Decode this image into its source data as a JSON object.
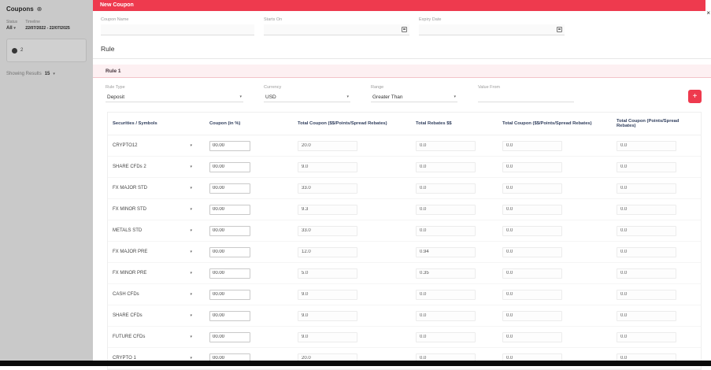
{
  "colors": {
    "accent": "#ee3a4e",
    "rule_header_bg": "#fdf0f2",
    "table_header_text": "#32405f"
  },
  "sidebar": {
    "title": "Coupons",
    "add_icon": "⊕",
    "status_label": "Status",
    "status_value": "All",
    "timeline_label": "Timeline",
    "timeline_value": "22/07/2022 - 22/07/2025",
    "card_badge": "2",
    "showing_results_label": "Showing Results",
    "showing_results_value": "15"
  },
  "modal": {
    "title": "New Coupon",
    "close_label": "×",
    "fields": {
      "coupon_name_label": "Coupon Name",
      "starts_on_label": "Starts On",
      "expiry_date_label": "Expiry Date"
    },
    "rule_section_title": "Rule",
    "rule1": {
      "title": "Rule 1",
      "rule_type_label": "Rule Type",
      "rule_type_value": "Deposit",
      "currency_label": "Currency",
      "currency_value": "USD",
      "range_label": "Range",
      "range_value": "Greater Than",
      "value_from_label": "Value From",
      "add_button_label": "+"
    },
    "table": {
      "columns": [
        "Securities / Symbols",
        "Coupon (in %)",
        "Total Coupon ($$/Points/Spread Rebates)",
        "Total Rebates $$",
        "Total Coupon ($$/Points/Spread Rebates)",
        "Total Coupon (Points/Spread Rebates)"
      ],
      "rows": [
        {
          "symbol": "CRYPTO12",
          "coupon": "00.00",
          "total_coupon_1": "20.0",
          "total_rebates": "0.0",
          "total_coupon_2": "0.0",
          "total_coupon_3": "0.0"
        },
        {
          "symbol": "SHARE CFDs 2",
          "coupon": "00.00",
          "total_coupon_1": "9.0",
          "total_rebates": "0.0",
          "total_coupon_2": "0.0",
          "total_coupon_3": "0.0"
        },
        {
          "symbol": "FX MAJOR STD",
          "coupon": "00.00",
          "total_coupon_1": "33.0",
          "total_rebates": "0.0",
          "total_coupon_2": "0.0",
          "total_coupon_3": "0.0"
        },
        {
          "symbol": "FX MINOR STD",
          "coupon": "00.00",
          "total_coupon_1": "9.3",
          "total_rebates": "0.0",
          "total_coupon_2": "0.0",
          "total_coupon_3": "0.0"
        },
        {
          "symbol": "METALS STD",
          "coupon": "00.00",
          "total_coupon_1": "33.0",
          "total_rebates": "0.0",
          "total_coupon_2": "0.0",
          "total_coupon_3": "0.0"
        },
        {
          "symbol": "FX MAJOR PRE",
          "coupon": "00.00",
          "total_coupon_1": "12.0",
          "total_rebates": "0.94",
          "total_coupon_2": "0.0",
          "total_coupon_3": "0.0"
        },
        {
          "symbol": "FX MINOR PRE",
          "coupon": "00.00",
          "total_coupon_1": "5.0",
          "total_rebates": "0.35",
          "total_coupon_2": "0.0",
          "total_coupon_3": "0.0"
        },
        {
          "symbol": "CASH CFDs",
          "coupon": "00.00",
          "total_coupon_1": "9.0",
          "total_rebates": "0.0",
          "total_coupon_2": "0.0",
          "total_coupon_3": "0.0"
        },
        {
          "symbol": "SHARE CFDs",
          "coupon": "00.00",
          "total_coupon_1": "9.0",
          "total_rebates": "0.0",
          "total_coupon_2": "0.0",
          "total_coupon_3": "0.0"
        },
        {
          "symbol": "FUTURE CFDs",
          "coupon": "00.00",
          "total_coupon_1": "9.0",
          "total_rebates": "0.0",
          "total_coupon_2": "0.0",
          "total_coupon_3": "0.0"
        },
        {
          "symbol": "CRYPTO 1",
          "coupon": "00.00",
          "total_coupon_1": "20.0",
          "total_rebates": "0.0",
          "total_coupon_2": "0.0",
          "total_coupon_3": "0.0"
        }
      ]
    }
  }
}
